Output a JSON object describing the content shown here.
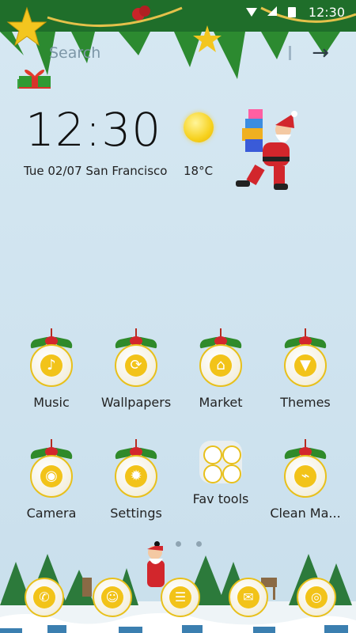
{
  "status_bar": {
    "time": "12:30"
  },
  "search": {
    "placeholder": "Search"
  },
  "clock_widget": {
    "time": "12:30",
    "date": "Tue  02/07  San Francisco",
    "temperature": "18°C",
    "weather_icon": "sun-icon"
  },
  "apps": [
    {
      "label": "Music",
      "icon": "music-note-icon"
    },
    {
      "label": "Wallpapers",
      "icon": "refresh-icon"
    },
    {
      "label": "Market",
      "icon": "store-icon"
    },
    {
      "label": "Themes",
      "icon": "tshirt-icon"
    },
    {
      "label": "Camera",
      "icon": "camera-icon"
    },
    {
      "label": "Settings",
      "icon": "gear-icon"
    },
    {
      "label": "Fav tools",
      "icon": "folder-icon"
    },
    {
      "label": "Clean Ma...",
      "icon": "broom-icon"
    }
  ],
  "page_indicator": {
    "pages": 3,
    "active": 1
  },
  "dock": [
    {
      "icon": "phone-icon"
    },
    {
      "icon": "contacts-icon"
    },
    {
      "icon": "app-drawer-icon"
    },
    {
      "icon": "messages-icon"
    },
    {
      "icon": "browser-globe-icon"
    }
  ],
  "colors": {
    "sky": "#d6e8f2",
    "gold": "#f2c319",
    "ribbon": "#d2262c",
    "leaf": "#2f8a2a"
  }
}
